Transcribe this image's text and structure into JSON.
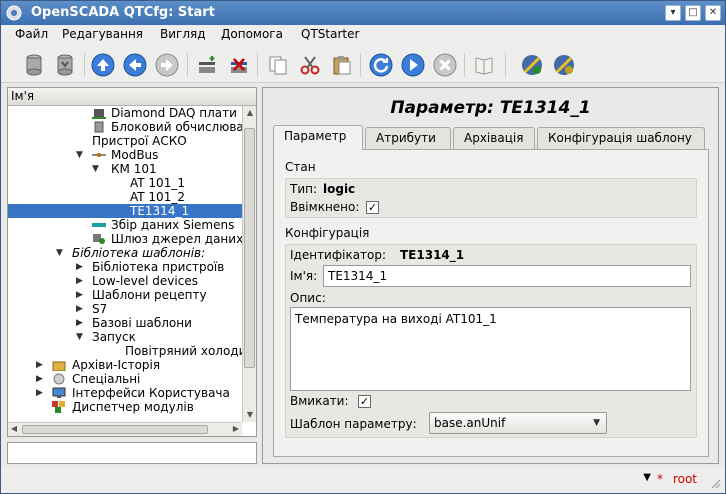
{
  "window": {
    "title": "OpenSCADA QTCfg: Start"
  },
  "menubar": [
    "Файл",
    "Редагування",
    "Вигляд",
    "Допомога",
    "QTStarter"
  ],
  "tree": {
    "header": "Ім'я",
    "rows": [
      {
        "label": "Diamond DAQ плати",
        "icon": "chip-icon"
      },
      {
        "label": "Блоковий обчислюва",
        "icon": "cylinder-icon"
      },
      {
        "label": "Пристрої АСКО",
        "icon": ""
      },
      {
        "label": "ModBus",
        "icon": "modbus-icon"
      },
      {
        "label": "КМ 101",
        "icon": ""
      },
      {
        "label": "AT 101_1",
        "icon": ""
      },
      {
        "label": "AT 101_2",
        "icon": ""
      },
      {
        "label": "TE1314_1",
        "icon": ""
      },
      {
        "label": "Збір даних Siemens",
        "icon": "siemens-icon"
      },
      {
        "label": "Шлюз джерел даних",
        "icon": "gateway-icon"
      },
      {
        "label": "Бібліотека шаблонів:",
        "icon": ""
      },
      {
        "label": "Бібліотека пристроїв",
        "icon": ""
      },
      {
        "label": "Low-level devices",
        "icon": ""
      },
      {
        "label": "Шаблони рецепту",
        "icon": ""
      },
      {
        "label": "S7",
        "icon": ""
      },
      {
        "label": "Базові шаблони",
        "icon": ""
      },
      {
        "label": "Запуск",
        "icon": ""
      },
      {
        "label": "Повітряний холодил",
        "icon": ""
      },
      {
        "label": "Архіви-Історія",
        "icon": "archive-icon"
      },
      {
        "label": "Спеціальні",
        "icon": "special-icon"
      },
      {
        "label": "Інтерфейси Користувача",
        "icon": "monitor-icon"
      },
      {
        "label": "Диспетчер модулів",
        "icon": "modules-icon"
      }
    ]
  },
  "main": {
    "title": "Параметр: TE1314_1",
    "tabs": [
      "Параметр",
      "Атрибути",
      "Архівація",
      "Конфігурація шаблону"
    ],
    "state": {
      "section": "Стан",
      "type_label": "Тип:",
      "type_value": "logic",
      "enabled_label": "Ввімкнено:",
      "enabled_checked": "✓"
    },
    "config": {
      "section": "Конфігурація",
      "id_label": "Ідентифікатор:",
      "id_value": "TE1314_1",
      "name_label": "Ім'я:",
      "name_value": "TE1314_1",
      "descr_label": "Опис:",
      "descr_value": "Температура на виході AT101_1",
      "on_label": "Вмикати:",
      "on_checked": "✓",
      "template_label": "Шаблон параметру:",
      "template_value": "base.anUnif"
    }
  },
  "status": {
    "user": "root"
  },
  "colors": {
    "titlebar": "#3b6fb0",
    "selection": "#3875c6",
    "user": "#cc0000"
  }
}
